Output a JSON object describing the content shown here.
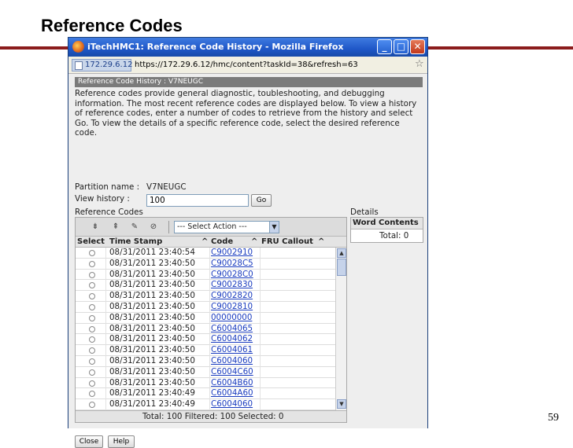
{
  "slide": {
    "title": "Reference Codes",
    "page_number": "59",
    "rule_color": "#8b1c1c"
  },
  "window": {
    "title": "iTechHMC1: Reference Code History - Mozilla Firefox",
    "address_host": "172.29.6.12",
    "url": "https://172.29.6.12/hmc/content?taskId=38&refresh=63",
    "min_icon": "minimize-icon",
    "max_icon": "maximize-icon",
    "close_icon": "close-icon"
  },
  "panel": {
    "header": "Reference Code History : V7NEUGC",
    "description": "Reference codes provide general diagnostic, toubleshooting, and debugging information. The most recent reference codes are displayed below. To view a history of reference codes, enter a number of codes to retrieve from the history and select Go. To view the details of a specific reference code, select the desired reference code.",
    "partition_label": "Partition name :",
    "partition_value": "V7NEUGC",
    "history_label": "View history :",
    "history_value": "100",
    "go_label": "Go"
  },
  "reference_codes": {
    "label": "Reference Codes",
    "action_select": "--- Select Action ---",
    "columns": {
      "select": "Select",
      "timestamp": "Time Stamp",
      "code": "Code",
      "fru": "FRU Callout"
    },
    "sort_marker": "^",
    "rows": [
      {
        "timestamp": "08/31/2011 23:40:54",
        "code": "C9002910"
      },
      {
        "timestamp": "08/31/2011 23:40:50",
        "code": "C90028C5"
      },
      {
        "timestamp": "08/31/2011 23:40:50",
        "code": "C90028C0"
      },
      {
        "timestamp": "08/31/2011 23:40:50",
        "code": "C9002830"
      },
      {
        "timestamp": "08/31/2011 23:40:50",
        "code": "C9002820"
      },
      {
        "timestamp": "08/31/2011 23:40:50",
        "code": "C9002810"
      },
      {
        "timestamp": "08/31/2011 23:40:50",
        "code": "00000000"
      },
      {
        "timestamp": "08/31/2011 23:40:50",
        "code": "C6004065"
      },
      {
        "timestamp": "08/31/2011 23:40:50",
        "code": "C6004062"
      },
      {
        "timestamp": "08/31/2011 23:40:50",
        "code": "C6004061"
      },
      {
        "timestamp": "08/31/2011 23:40:50",
        "code": "C6004060"
      },
      {
        "timestamp": "08/31/2011 23:40:50",
        "code": "C6004C60"
      },
      {
        "timestamp": "08/31/2011 23:40:50",
        "code": "C6004B60"
      },
      {
        "timestamp": "08/31/2011 23:40:49",
        "code": "C6004A60"
      },
      {
        "timestamp": "08/31/2011 23:40:49",
        "code": "C6004060"
      }
    ],
    "footer": "Total: 100    Filtered: 100    Selected: 0"
  },
  "details": {
    "label": "Details",
    "word_col": "Word",
    "contents_col": "Contents",
    "total": "Total: 0"
  },
  "buttons": {
    "close": "Close",
    "help": "Help"
  }
}
